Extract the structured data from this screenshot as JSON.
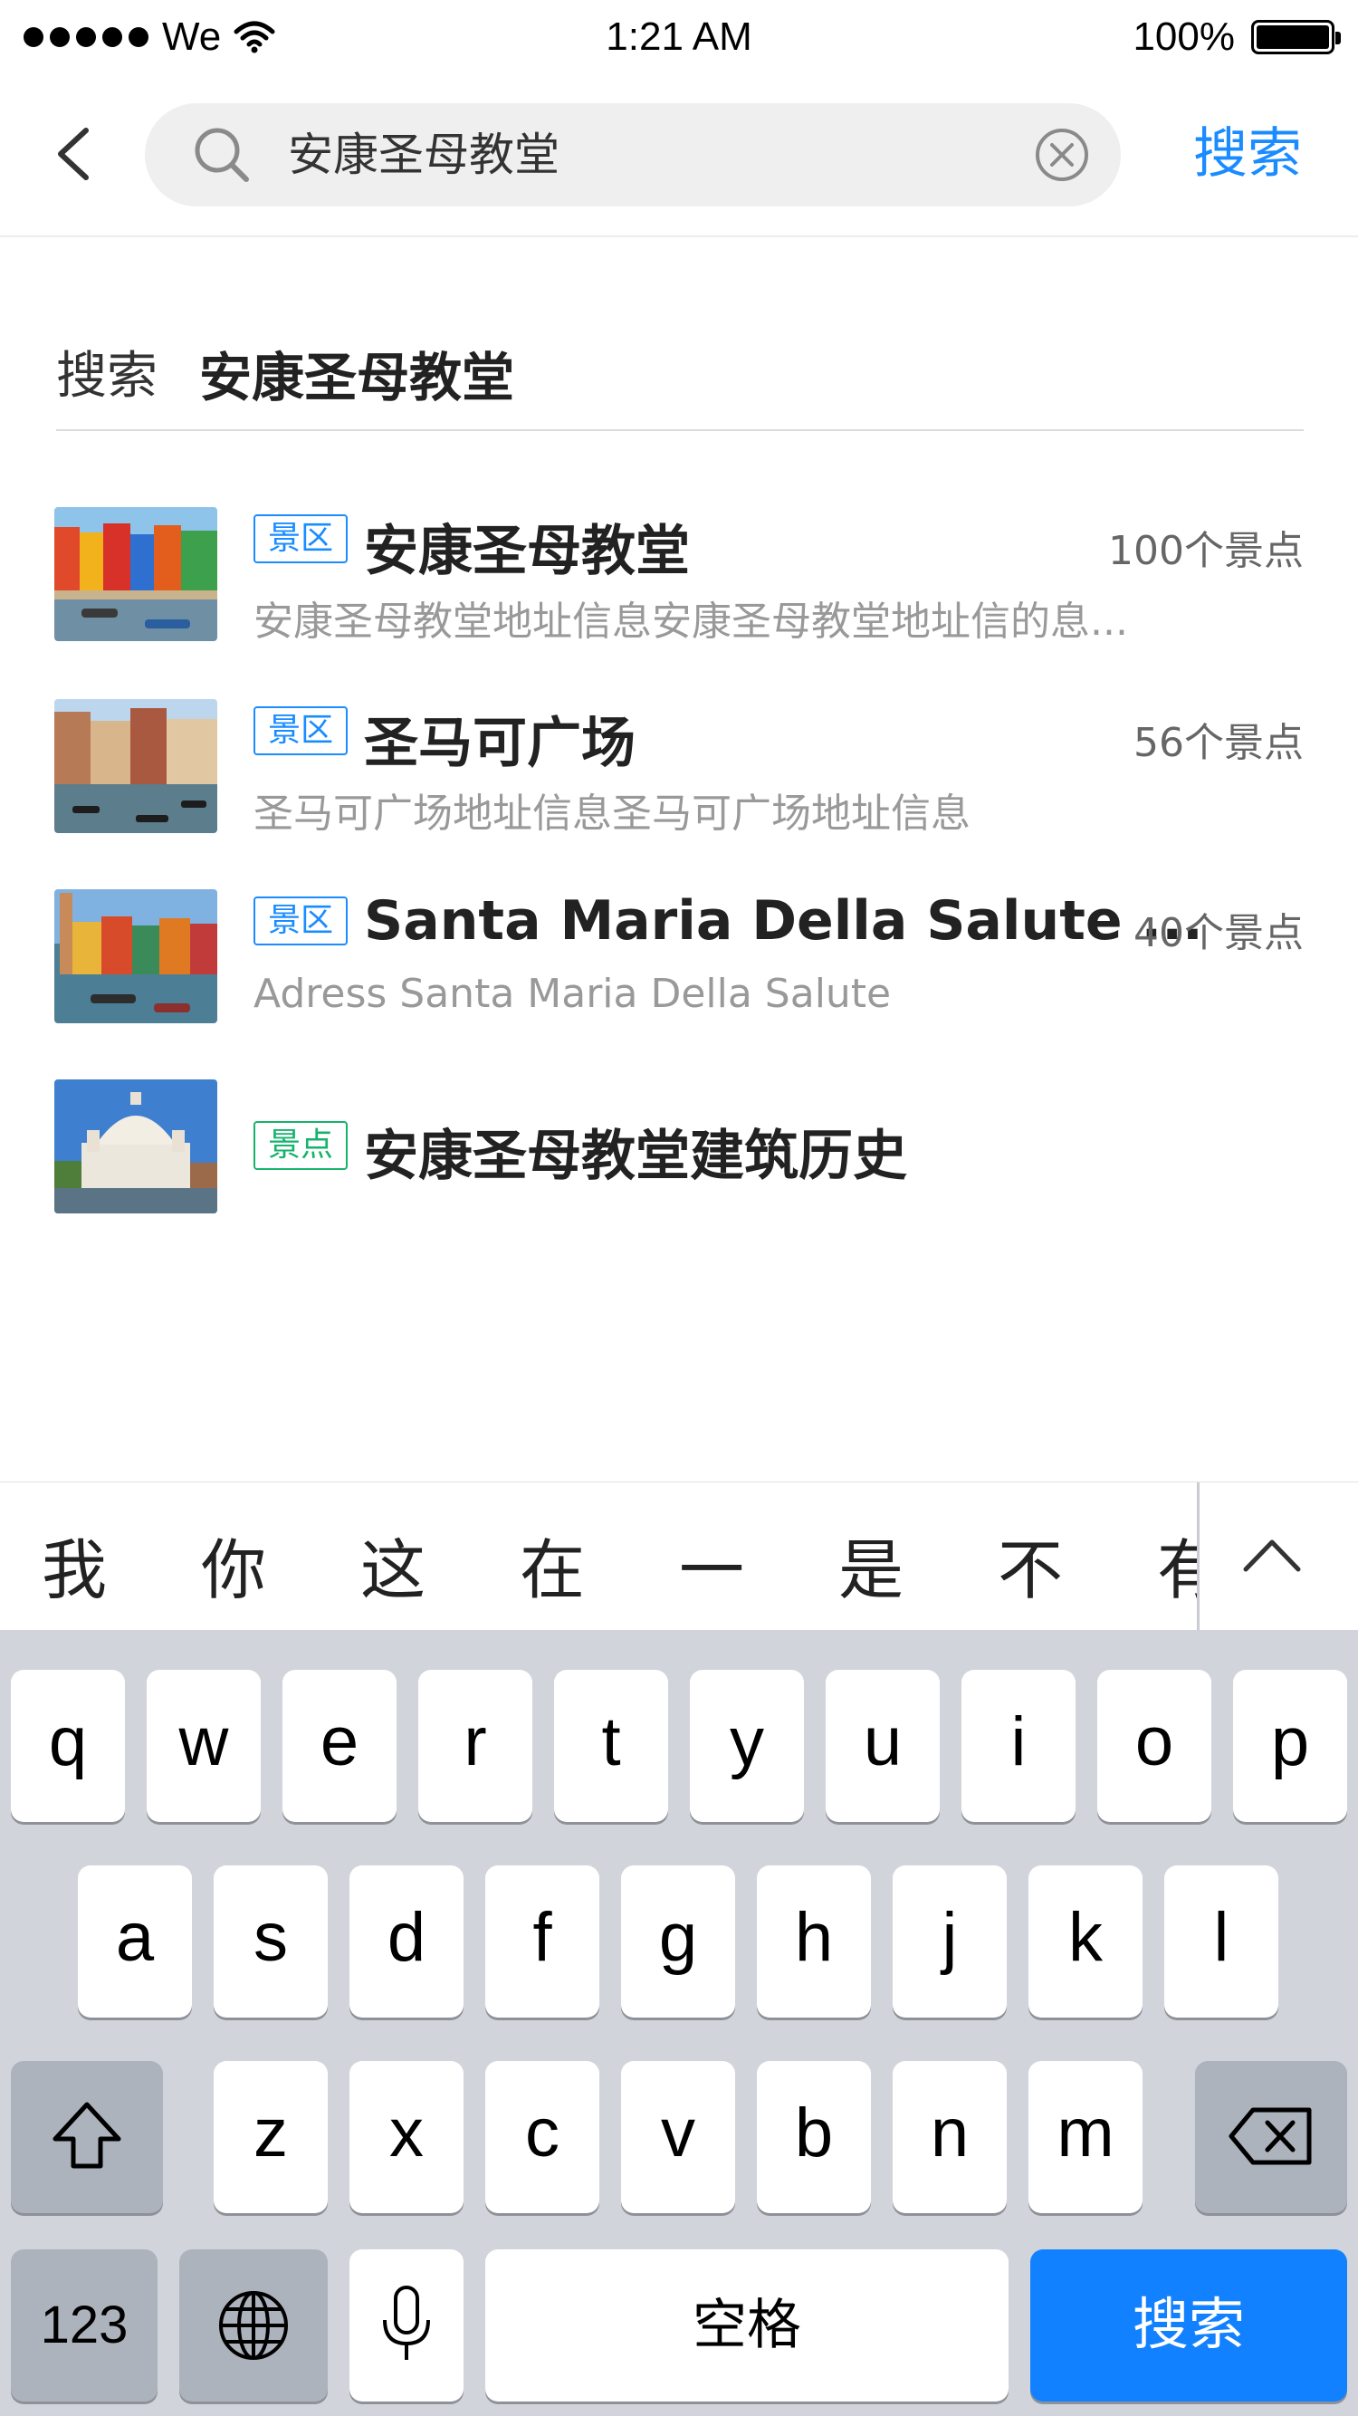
{
  "status_bar": {
    "carrier": "We",
    "time": "1:21 AM",
    "battery": "100%"
  },
  "search": {
    "query": "安康圣母教堂",
    "submit_label": "搜索"
  },
  "query_row": {
    "label": "搜索",
    "value": "安康圣母教堂"
  },
  "results": [
    {
      "tag": "景区",
      "tag_type": "scenic",
      "title": "安康圣母教堂",
      "count": "100个景点",
      "desc": "安康圣母教堂地址信息安康圣母教堂地址信的息..."
    },
    {
      "tag": "景区",
      "tag_type": "scenic",
      "title": "圣马可广场",
      "count": "56个景点",
      "desc": "圣马可广场地址信息圣马可广场地址信息"
    },
    {
      "tag": "景区",
      "tag_type": "scenic",
      "title": "Santa Maria Della Salute ...",
      "count": "40个景点",
      "desc": "Adress Santa Maria Della Salute"
    },
    {
      "tag": "景点",
      "tag_type": "spot",
      "title": "安康圣母教堂建筑历史",
      "count": "",
      "desc": ""
    }
  ],
  "candidates": [
    "我",
    "你",
    "这",
    "在",
    "一",
    "是",
    "不",
    "有"
  ],
  "keyboard": {
    "row1": [
      "q",
      "w",
      "e",
      "r",
      "t",
      "y",
      "u",
      "i",
      "o",
      "p"
    ],
    "row2": [
      "a",
      "s",
      "d",
      "f",
      "g",
      "h",
      "j",
      "k",
      "l"
    ],
    "row3": [
      "z",
      "x",
      "c",
      "v",
      "b",
      "n",
      "m"
    ],
    "numbers": "123",
    "space": "空格",
    "search": "搜索"
  },
  "colors": {
    "accent": "#1a8cff",
    "scenic_tag": "#1a8cff",
    "spot_tag": "#16b36b",
    "keyboard_bg": "#d1d5db",
    "keyboard_action": "#1281ff"
  }
}
